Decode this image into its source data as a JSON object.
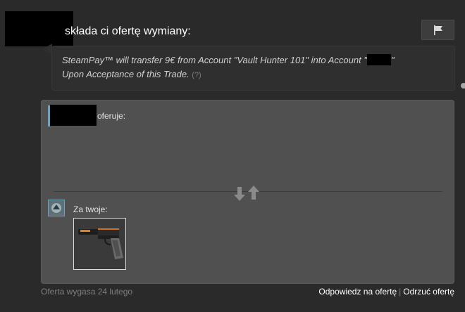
{
  "header": {
    "title": "składa ci ofertę wymiany:",
    "report_icon": "flag-icon"
  },
  "message": {
    "line1": "SteamPay™ will transfer 9€ from Account \"Vault Hunter 101\" into Account \"",
    "line1_end": "\"",
    "line2": "Upon Acceptance of this Trade.",
    "help": "(?)"
  },
  "trade": {
    "their_label": "oferuje:",
    "your_label": "Za twoje:",
    "swap_icon": "swap-arrows-icon",
    "items_yours": [
      {
        "name": "pistol-item",
        "icon": "pistol-icon"
      }
    ]
  },
  "footer": {
    "expires": "Oferta wygasa 24 lutego",
    "respond": "Odpowiedz na ofertę",
    "separator": "|",
    "decline": "Odrzuć ofertę"
  },
  "colors": {
    "background": "#2a2a2a",
    "panel": "#505050",
    "accent_blue": "#6aa4c0"
  }
}
